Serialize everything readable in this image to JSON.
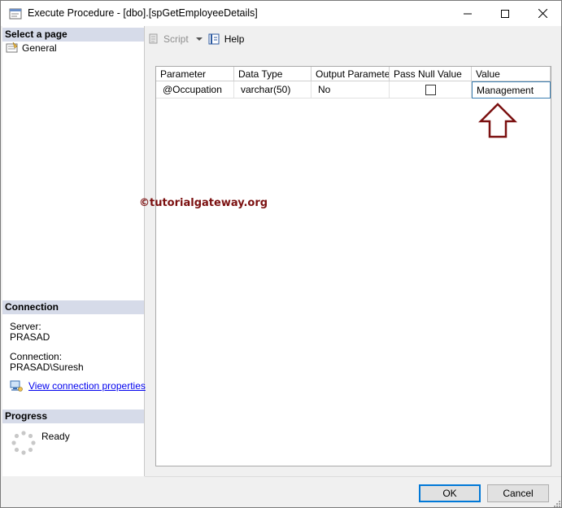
{
  "window": {
    "title": "Execute Procedure - [dbo].[spGetEmployeeDetails]"
  },
  "left_pane": {
    "select_page_header": "Select a page",
    "pages": [
      {
        "label": "General",
        "icon": "general-page-icon"
      }
    ],
    "connection_header": "Connection",
    "server_label": "Server:",
    "server_value": "PRASAD",
    "connection_label": "Connection:",
    "connection_value": "PRASAD\\Suresh",
    "view_connection_link": "View connection properties",
    "progress_header": "Progress",
    "progress_status": "Ready"
  },
  "toolbar": {
    "script_label": "Script",
    "help_label": "Help"
  },
  "grid": {
    "columns": [
      "Parameter",
      "Data Type",
      "Output Parameter",
      "Pass Null Value",
      "Value"
    ],
    "rows": [
      {
        "parameter": "@Occupation",
        "data_type": "varchar(50)",
        "output_parameter": "No",
        "pass_null_value": false,
        "value": "Management"
      }
    ]
  },
  "watermark": "©tutorialgateway.org",
  "buttons": {
    "ok": "OK",
    "cancel": "Cancel"
  },
  "colors": {
    "pane_header_bg": "#d6dbe9",
    "watermark": "#7b1010",
    "arrow": "#7b1010",
    "link": "#0000ee"
  }
}
